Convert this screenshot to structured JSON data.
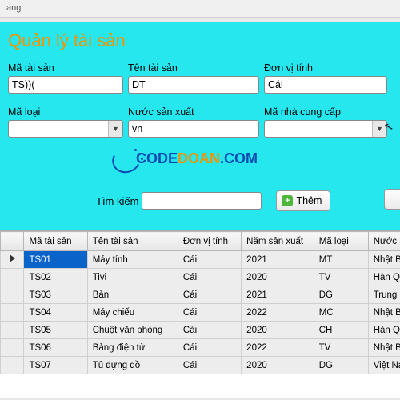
{
  "window": {
    "title_fragment": "ang"
  },
  "page_title": "Quản lý tài sản",
  "labels": {
    "ma_tai_san": "Mã tài sản",
    "ten_tai_san": "Tên tài sản",
    "don_vi_tinh": "Đơn vị tính",
    "ma_loai": "Mã loại",
    "nuoc_san_xuat": "Nước sản xuất",
    "ma_nha_cung_cap": "Mã nhà cung cấp",
    "tim_kiem": "Tìm kiếm"
  },
  "values": {
    "ma_tai_san": "TS))(",
    "ten_tai_san": "DT",
    "don_vi_tinh": "Cái",
    "ma_loai": "",
    "nuoc_san_xuat": "vn",
    "ma_nha_cung_cap": "",
    "tim_kiem": ""
  },
  "buttons": {
    "them": "Thêm"
  },
  "watermark": {
    "part1": "CODE",
    "part2": "DOAN",
    "part3": ".COM"
  },
  "grid": {
    "columns": [
      "Mã tài sản",
      "Tên tài sản",
      "Đơn vị tính",
      "Năm sản xuất",
      "Mã loại",
      "Nước S"
    ],
    "selected_row": 0,
    "selected_col": 0,
    "rows": [
      [
        "TS01",
        "Máy tính",
        "Cái",
        "2021",
        "MT",
        "Nhật Bả"
      ],
      [
        "TS02",
        "Tivi",
        "Cái",
        "2020",
        "TV",
        "Hàn Quố"
      ],
      [
        "TS03",
        "Bàn",
        "Cái",
        "2021",
        "DG",
        "Trung Qu"
      ],
      [
        "TS04",
        "Máy chiếu",
        "Cái",
        "2022",
        "MC",
        "Nhật Bả"
      ],
      [
        "TS05",
        "Chuột văn phòng",
        "Cái",
        "2020",
        "CH",
        "Hàn Quố"
      ],
      [
        "TS06",
        "Bảng điện tử",
        "Cái",
        "2022",
        "TV",
        "Nhật Bả"
      ],
      [
        "TS07",
        "Tủ đựng đồ",
        "Cái",
        "2020",
        "DG",
        "Việt Na"
      ]
    ]
  }
}
